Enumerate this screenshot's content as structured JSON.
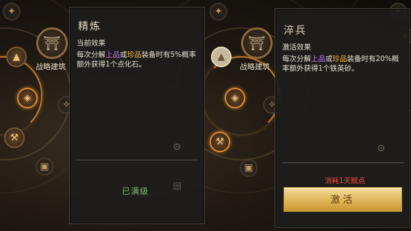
{
  "tree": {
    "building_label": "战略建筑"
  },
  "panel_left": {
    "title": "精炼",
    "section": "当前效果",
    "desc": [
      {
        "t": "每次分解",
        "c": ""
      },
      {
        "t": "上品",
        "c": "purple"
      },
      {
        "t": "或",
        "c": ""
      },
      {
        "t": "珍品",
        "c": "yellow"
      },
      {
        "t": "装备时有5%概率额外获得1个点化石。",
        "c": ""
      }
    ],
    "status": "已满级"
  },
  "panel_right": {
    "title": "淬兵",
    "section": "激活效果",
    "desc": [
      {
        "t": "每次分解",
        "c": ""
      },
      {
        "t": "上品",
        "c": "purple"
      },
      {
        "t": "或",
        "c": ""
      },
      {
        "t": "珍品",
        "c": "yellow"
      },
      {
        "t": "装备时有20%概率额外获得1个铁英砂。",
        "c": ""
      }
    ],
    "cost": "消耗1天赋点",
    "activate_label": "激活"
  },
  "icons": {
    "building": "pagoda-icon",
    "mound": "mound-icon",
    "shield": "shield-icon",
    "hammer": "hammer-icon",
    "gear": "gear-icon"
  }
}
